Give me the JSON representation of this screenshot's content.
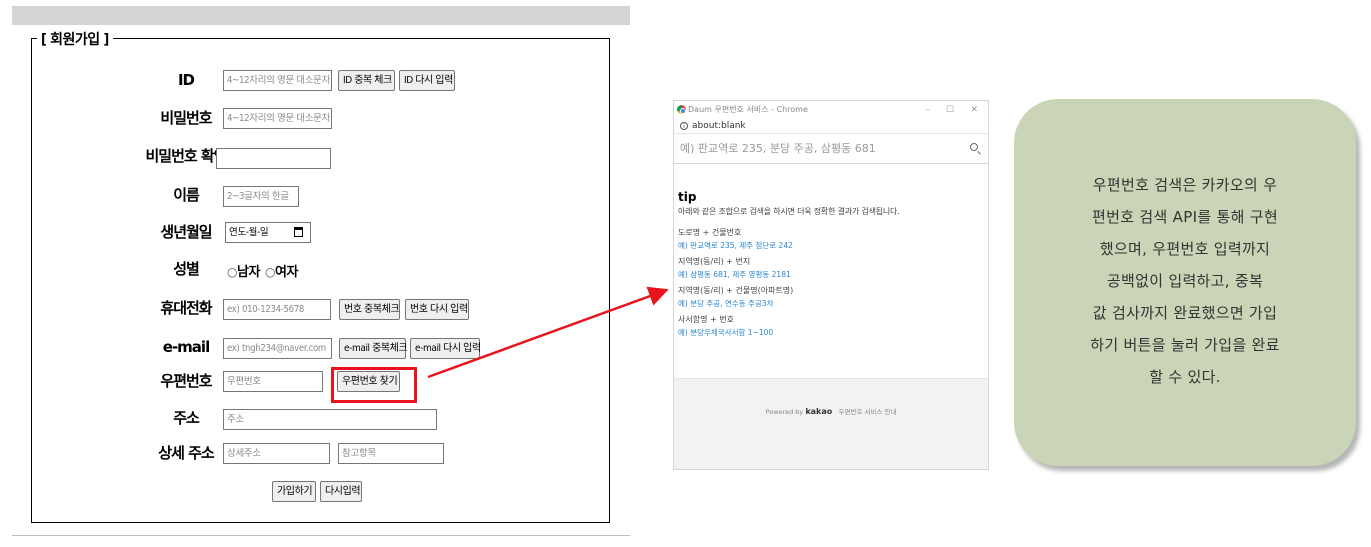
{
  "form": {
    "legend": "[ 회원가입 ]",
    "fields": {
      "id": {
        "label": "ID",
        "placeholder": "4~12자리의 영문 대소문자",
        "btn_check": "ID 중복 체크",
        "btn_reset": "ID 다시 입력"
      },
      "password": {
        "label": "비밀번호",
        "placeholder": "4~12자리의 영문 대소문자"
      },
      "password_confirm": {
        "label": "비밀번호 확인",
        "placeholder": ""
      },
      "name": {
        "label": "이름",
        "placeholder": "2~3글자의 한글"
      },
      "birth": {
        "label": "생년월일",
        "value": "연도-월-일"
      },
      "gender": {
        "label": "성별",
        "options": [
          "남자",
          "여자"
        ]
      },
      "phone": {
        "label": "휴대전화",
        "placeholder": "ex) 010-1234-5678",
        "btn_check": "번호 중복체크",
        "btn_reset": "번호 다시 입력"
      },
      "email": {
        "label": "e-mail",
        "placeholder": "ex) tngh234@naver.com",
        "btn_check": "e-mail 중복체크",
        "btn_reset": "e-mail 다시 입력"
      },
      "zipcode": {
        "label": "우편번호",
        "placeholder": "우편번호",
        "btn_find": "우편번호 찾기"
      },
      "address": {
        "label": "주소",
        "placeholder": "주소"
      },
      "detail_address": {
        "label": "상세 주소",
        "placeholder": "상세주소",
        "extra_placeholder": "참고항목"
      }
    },
    "submit_label": "가입하기",
    "reset_label": "다시입력"
  },
  "popup": {
    "window_title": "Daum 우편번호 서비스 - Chrome",
    "window_controls": {
      "minimize": "–",
      "maximize": "☐",
      "close": "✕"
    },
    "url": "about:blank",
    "search_placeholder": "예) 판교역로 235, 분당 주공, 삼평동 681",
    "tip": {
      "heading": "tip",
      "description": "아래와 같은 조합으로 검색을 하시면 더욱 정확한 결과가 검색됩니다.",
      "items": [
        {
          "category": "도로명 + 건물번호",
          "example": "예) 판교역로 235,  제주 첨단로 242"
        },
        {
          "category": "지역명(동/리) + 번지",
          "example": "예) 삼평동 681,  제주 영평동 2181"
        },
        {
          "category": "지역명(동/리) + 건물명(아파트명)",
          "example": "예) 분당 주공,  연수동 주공3차"
        },
        {
          "category": "사서함명 + 번호",
          "example": "예) 분당우체국사서함 1~100"
        }
      ]
    },
    "footer": {
      "powered_by": "Powered by",
      "brand": "kakao",
      "service_link": "우편번호 서비스 안내"
    }
  },
  "note": {
    "text": "우편번호 검색은 카카오의 우\n편번호 검색 API를 통해 구현\n했으며, 우편번호 입력까지\n  공백없이 입력하고, 중복\n값 검사까지 완료했으면 가입\n하기 버튼을 눌러 가입을 완료\n할 수 있다."
  },
  "colors": {
    "highlight": "#e8141d",
    "note_bg": "#c9d5b6",
    "link": "#2b87d1"
  }
}
